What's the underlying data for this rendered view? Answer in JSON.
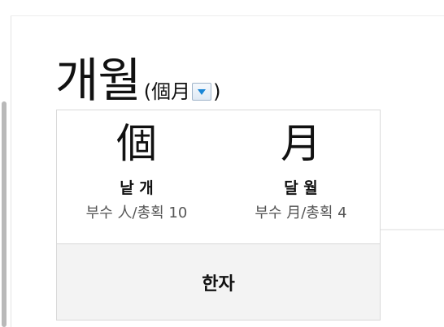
{
  "entry": {
    "word": "개월",
    "hanja_open": "(",
    "hanja": "個月",
    "hanja_close": ")"
  },
  "characters": [
    {
      "char": "個",
      "meaning": "낱 개",
      "info": "부수 人/총획 10"
    },
    {
      "char": "月",
      "meaning": "달 월",
      "info": "부수 月/총획 4"
    }
  ],
  "footer": {
    "label": "한자"
  },
  "icons": {
    "dropdown": "chevron-down-icon",
    "accent": "#1a86d6"
  }
}
